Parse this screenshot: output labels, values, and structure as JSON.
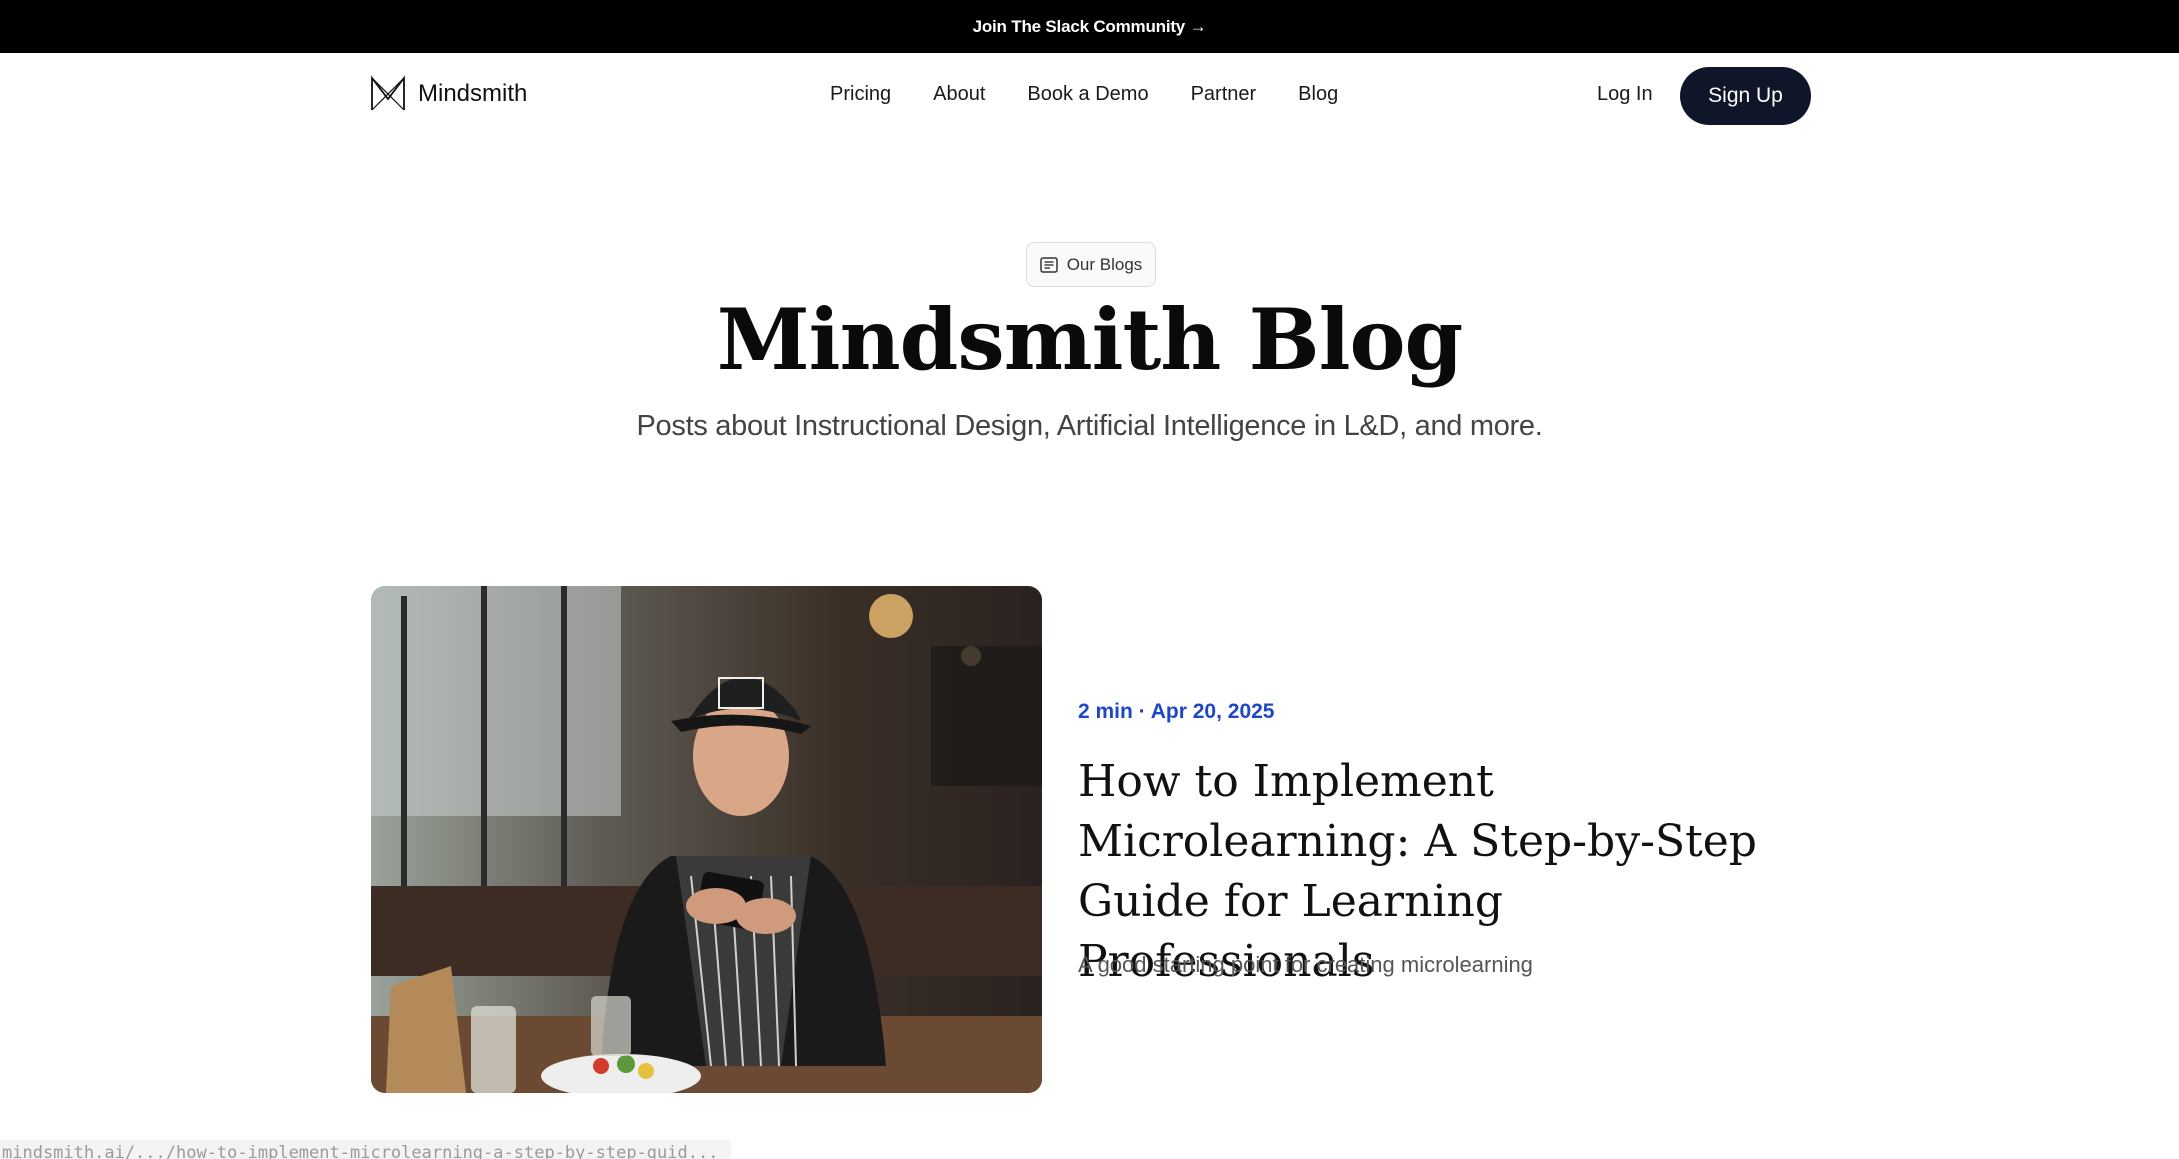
{
  "topbar": {
    "text": "Join The Slack Community →"
  },
  "nav": {
    "logo_text": "Mindsmith",
    "links": [
      "Pricing",
      "About",
      "Book a Demo",
      "Partner",
      "Blog"
    ],
    "login": "Log In",
    "signup": "Sign Up"
  },
  "hero": {
    "badge": "Our Blogs",
    "badge_icon": "document-icon",
    "title": "Mindsmith Blog",
    "subtitle": "Posts about Instructional Design, Artificial Intelligence in L&D, and more."
  },
  "post": {
    "meta": "2 min · Apr 20, 2025",
    "title": "How to Implement Microlearning: A Step-by-Step Guide for Learning Professionals",
    "description": "A good starting point for creating microlearning",
    "image_subject": "woman in cap and striped apron using phone in restaurant"
  },
  "status_bar": {
    "url": "mindsmith.ai/.../how-to-implement-microlearning-a-step-by-step-guid..."
  },
  "colors": {
    "accent_blue": "#1f46c8",
    "button_dark": "#0f1629",
    "topbar_bg": "#000000"
  }
}
